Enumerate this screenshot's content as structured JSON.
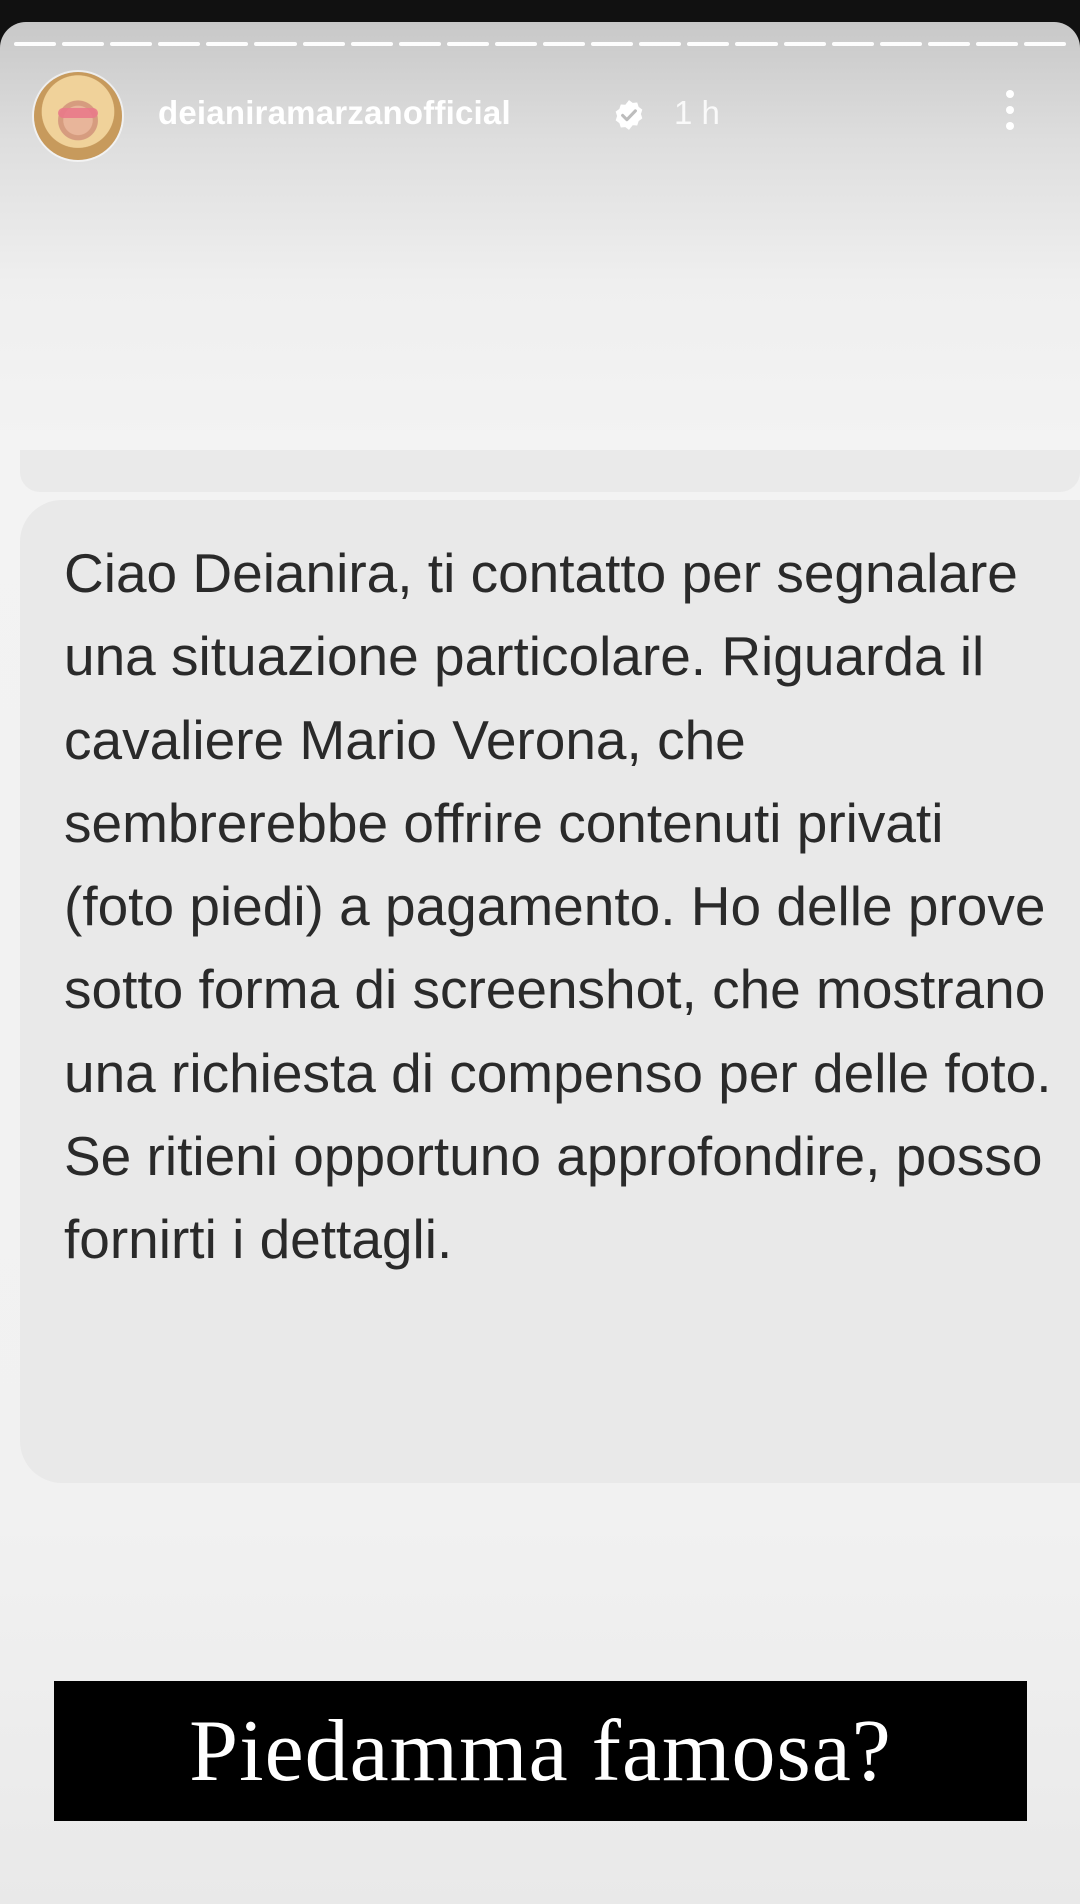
{
  "story": {
    "segments": 22,
    "username": "deianiramarzanofficial",
    "time": "1 h",
    "avatar_icon": "avatar-photo",
    "verified_icon": "verified-badge-icon",
    "more_icon": "more-vertical-icon"
  },
  "message": {
    "text": "Ciao Deianira, ti contatto per segnalare una situazione particolare. Riguarda il cavaliere Mario Verona, che sembrerebbe offrire contenuti privati (foto piedi) a pagamento. Ho delle prove sotto forma di screenshot, che mostrano una richiesta di compenso per delle foto. Se ritieni opportuno approfondire, posso fornirti i dettagli."
  },
  "caption": {
    "text": "Piedamma famosa?"
  },
  "colors": {
    "bubble": "#e9e9e9",
    "caption_bg": "#000000",
    "caption_text": "#ffffff",
    "message_text": "#2a2a2a"
  }
}
